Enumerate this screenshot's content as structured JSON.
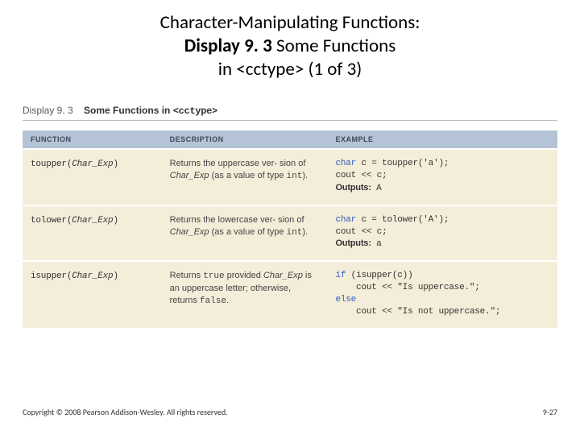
{
  "title": {
    "line1": "Character-Manipulating Functions:",
    "line2_bold": "Display 9. 3",
    "line2_rest": "  Some Functions",
    "line3": "in <cctype> (1 of 3)"
  },
  "display_caption": {
    "prefix": "Display 9. 3",
    "mid": "Some Functions in",
    "code": "<cctype>"
  },
  "headers": {
    "h1": "FUNCTION",
    "h2": "DESCRIPTION",
    "h3": "EXAMPLE"
  },
  "rows": [
    {
      "fn_name": "toupper",
      "fn_arg": "Char_Exp",
      "desc_pre": "Returns the uppercase ver-\nsion of ",
      "desc_it": "Char_Exp",
      "desc_post": " (as a\nvalue of type ",
      "desc_kw": "int",
      "desc_end": ").",
      "ex_l1_pre": "char",
      "ex_l1_post": " c = toupper('a');",
      "ex_l2": "cout << c;",
      "ex_out_label": "Outputs:",
      "ex_out_val": " A"
    },
    {
      "fn_name": "tolower",
      "fn_arg": "Char_Exp",
      "desc_pre": "Returns the lowercase ver-\nsion of ",
      "desc_it": "Char_Exp",
      "desc_post": " (as a\nvalue of type ",
      "desc_kw": "int",
      "desc_end": ").",
      "ex_l1_pre": "char",
      "ex_l1_post": " c = tolower('A');",
      "ex_l2": "cout << c;",
      "ex_out_label": "Outputs:",
      "ex_out_val": " a"
    },
    {
      "fn_name": "isupper",
      "fn_arg": "Char_Exp",
      "desc_pre2": "Returns ",
      "desc_kw1": "true",
      "desc_mid2": " provided\n",
      "desc_it2": "Char_Exp",
      "desc_mid3": " is an uppercase\nletter; otherwise, returns\n",
      "desc_kw2": "false",
      "desc_end2": ".",
      "ex_if": "if",
      "ex_if_rest": " (isupper(c))",
      "ex_l2b": "    cout << \"Is uppercase.\";",
      "ex_else": "else",
      "ex_l4b": "    cout << \"Is not uppercase.\";"
    }
  ],
  "footer": {
    "left": "Copyright © 2008 Pearson Addison-Wesley. All rights reserved.",
    "right": "9-27"
  }
}
